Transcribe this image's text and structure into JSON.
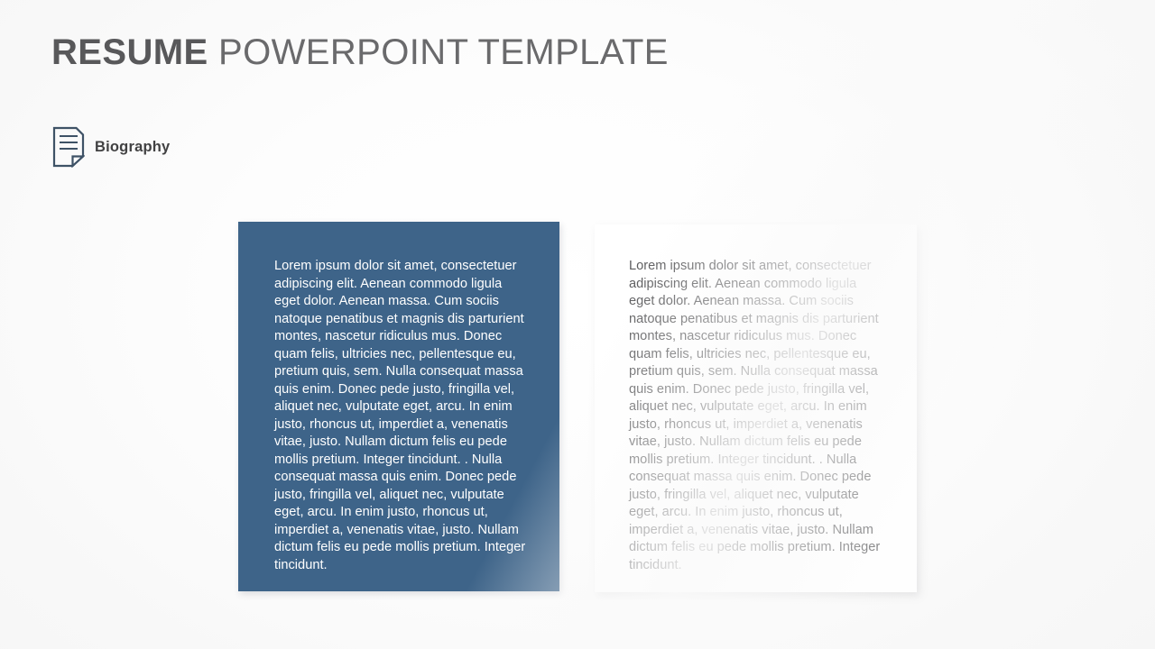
{
  "slide": {
    "background_color": "#fbfbfb",
    "title": {
      "strong_part": "RESUME",
      "light_part": " POWERPOINT TEMPLATE",
      "color": "#58585a"
    },
    "section": {
      "icon": "document-lines-icon",
      "icon_color": "#3e5266",
      "label": "Biography"
    },
    "panels": [
      {
        "name": "biography-panel-filled",
        "style": "filled",
        "background_color": "#3e6489",
        "text_color": "#ffffff",
        "text": "Lorem ipsum dolor sit amet, consectetuer adipiscing elit. Aenean commodo  ligula eget dolor.  Aenean massa. Cum sociis natoque penatibus et magnis dis parturient montes, nascetur ridiculus mus. Donec quam felis, ultricies nec, pellentesque eu, pretium quis, sem. Nulla consequat massa quis enim. Donec pede justo, fringilla vel, aliquet nec, vulputate eget, arcu. In enim justo, rhoncus ut, imperdiet a, venenatis vitae, justo. Nullam dictum felis eu pede mollis pretium.  Integer tincidunt. . Nulla consequat massa quis enim. Donec pede justo, fringilla vel, aliquet nec, vulputate eget, arcu. In enim justo, rhoncus ut, imperdiet a, venenatis vitae, justo. Nullam dictum felis eu pede mollis pretium. Integer tincidunt."
      },
      {
        "name": "biography-panel-plain",
        "style": "plain",
        "background_color": "#ffffff",
        "text_color": "#5c5c5e",
        "text": "Lorem ipsum dolor sit amet, consectetuer adipiscing elit. Aenean commodo  ligula eget dolor.  Aenean massa. Cum sociis natoque penatibus et magnis dis parturient montes, nascetur ridiculus mus. Donec quam felis, ultricies nec, pellentesque eu, pretium quis, sem. Nulla consequat massa quis enim. Donec pede justo, fringilla vel, aliquet nec, vulputate eget, arcu. In enim justo, rhoncus ut, imperdiet a, venenatis vitae, justo. Nullam dictum felis eu pede mollis pretium.  Integer tincidunt. . Nulla consequat massa quis enim. Donec pede justo, fringilla vel, aliquet nec, vulputate eget, arcu. In enim justo, rhoncus ut, imperdiet a, venenatis vitae, justo. Nullam dictum felis eu pede mollis pretium. Integer tincidunt."
      }
    ]
  }
}
